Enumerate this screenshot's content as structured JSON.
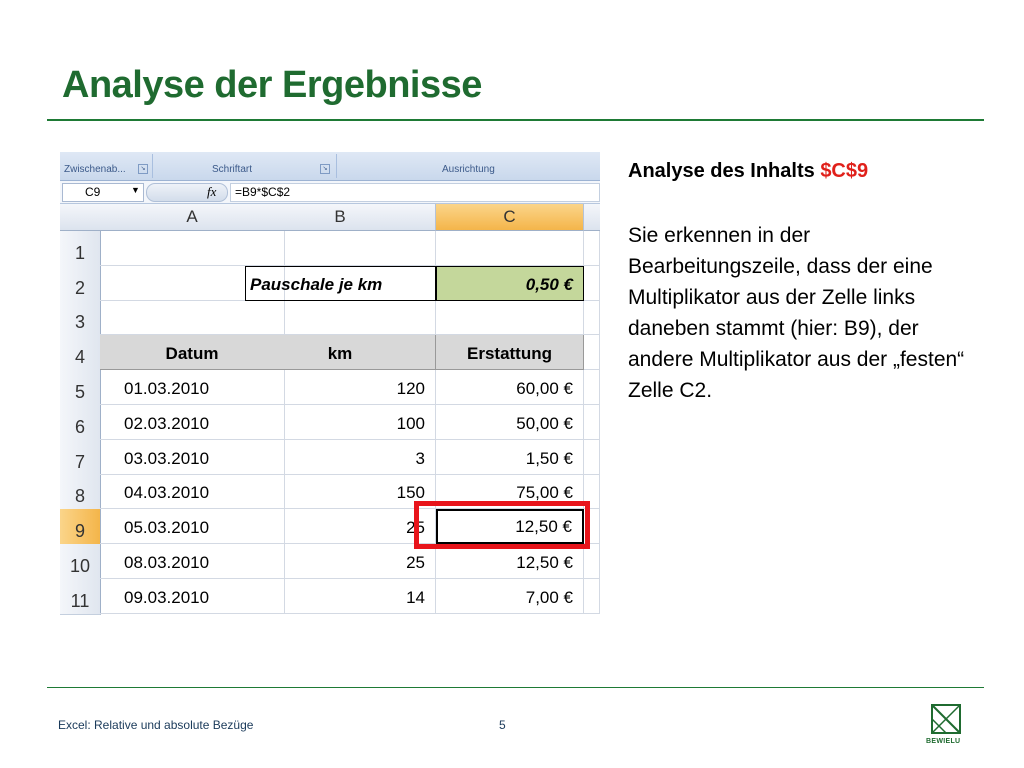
{
  "slide": {
    "title": "Analyse der Ergebnisse",
    "right_heading_prefix": "Analyse des Inhalts",
    "right_heading_ref": "$C$9",
    "right_body": "Sie erkennen in der Bearbeitungszeile, dass der eine Multiplikator aus der Zelle links daneben stammt (hier: B9), der andere Multiplikator aus der „festen“ Zelle C2.",
    "footer_left": "Excel: Relative und absolute Bezüge",
    "footer_page": "5",
    "logo_text": "BEWIELU"
  },
  "colors": {
    "accent_green": "#1f6b30",
    "highlight_red": "#e8141b",
    "ref_red": "#e0201a",
    "cell_green": "#c4d79b"
  },
  "excel": {
    "ribbon_groups": [
      "Zwischenab...",
      "Schriftart",
      "Ausrichtung"
    ],
    "name_box": "C9",
    "fx_label": "fx",
    "formula": "=B9*$C$2",
    "columns": [
      "A",
      "B",
      "C"
    ],
    "rows": [
      {
        "num": "1",
        "a": "",
        "b": "",
        "c": ""
      },
      {
        "num": "2",
        "a": "",
        "b": "Pauschale je km",
        "c": "0,50 €"
      },
      {
        "num": "3",
        "a": "",
        "b": "",
        "c": ""
      },
      {
        "num": "4",
        "a": "Datum",
        "b": "km",
        "c": "Erstattung"
      },
      {
        "num": "5",
        "a": "01.03.2010",
        "b": "120",
        "c": "60,00 €"
      },
      {
        "num": "6",
        "a": "02.03.2010",
        "b": "100",
        "c": "50,00 €"
      },
      {
        "num": "7",
        "a": "03.03.2010",
        "b": "3",
        "c": "1,50 €"
      },
      {
        "num": "8",
        "a": "04.03.2010",
        "b": "150",
        "c": "75,00 €"
      },
      {
        "num": "9",
        "a": "05.03.2010",
        "b": "25",
        "c": "12,50 €"
      },
      {
        "num": "10",
        "a": "08.03.2010",
        "b": "25",
        "c": "12,50 €"
      },
      {
        "num": "11",
        "a": "09.03.2010",
        "b": "14",
        "c": "7,00 €"
      }
    ]
  }
}
